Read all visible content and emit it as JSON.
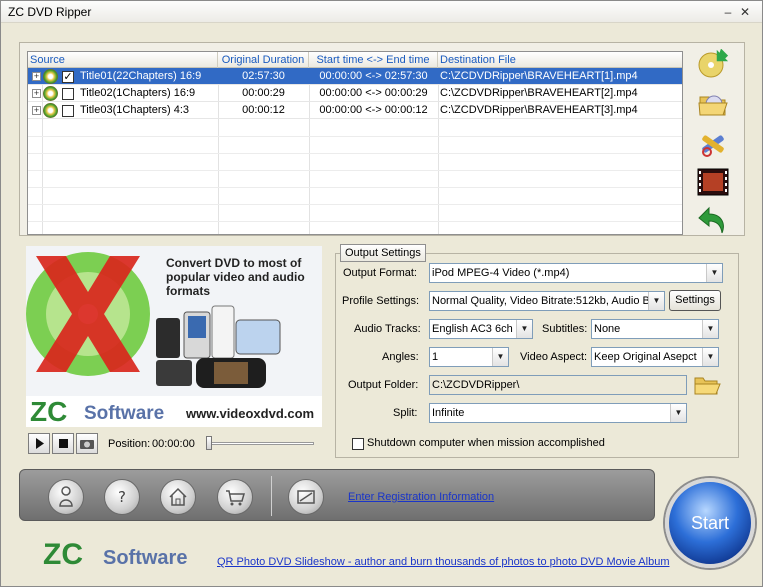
{
  "window": {
    "title": "ZC DVD Ripper"
  },
  "grid": {
    "headers": [
      "Source",
      "Original Duration",
      "Start time <-> End time",
      "Destination File"
    ],
    "rows": [
      {
        "source": "Title01(22Chapters) 16:9",
        "duration": "02:57:30",
        "range": "00:00:00 <-> 02:57:30",
        "dest": "C:\\ZCDVDRipper\\BRAVEHEART[1].mp4",
        "checked": true,
        "selected": true
      },
      {
        "source": "Title02(1Chapters) 16:9",
        "duration": "00:00:29",
        "range": "00:00:00 <-> 00:00:29",
        "dest": "C:\\ZCDVDRipper\\BRAVEHEART[2].mp4",
        "checked": false,
        "selected": false
      },
      {
        "source": "Title03(1Chapters) 4:3",
        "duration": "00:00:12",
        "range": "00:00:00 <-> 00:00:12",
        "dest": "C:\\ZCDVDRipper\\BRAVEHEART[3].mp4",
        "checked": false,
        "selected": false
      }
    ]
  },
  "banner": {
    "headline": "Convert DVD to most of popular video and audio formats",
    "logo_zc": "ZC",
    "logo_software": "Software",
    "url": "www.videoxdvd.com"
  },
  "player": {
    "position_label": "Position:",
    "position_value": "00:00:00"
  },
  "output": {
    "tab": "Output Settings",
    "format_label": "Output Format:",
    "format_value": "iPod MPEG-4 Video (*.mp4)",
    "profile_label": "Profile Settings:",
    "profile_value": "Normal Quality, Video Bitrate:512kb, Audio B",
    "settings_button": "Settings",
    "audio_label": "Audio Tracks:",
    "audio_value": "English AC3  6ch",
    "subtitles_label": "Subtitles:",
    "subtitles_value": "None",
    "angles_label": "Angles:",
    "angles_value": "1",
    "aspect_label": "Video Aspect:",
    "aspect_value": "Keep Original Asepct",
    "folder_label": "Output Folder:",
    "folder_value": "C:\\ZCDVDRipper\\",
    "split_label": "Split:",
    "split_value": "Infinite",
    "shutdown_label": "Shutdown computer when mission accomplished"
  },
  "bottom": {
    "register_link": "Enter Registration Information",
    "start_label": "Start",
    "footer_zc": "ZC",
    "footer_software": "Software",
    "promo_link": "QR Photo DVD Slideshow - author and burn thousands of photos to photo DVD Movie Album"
  }
}
